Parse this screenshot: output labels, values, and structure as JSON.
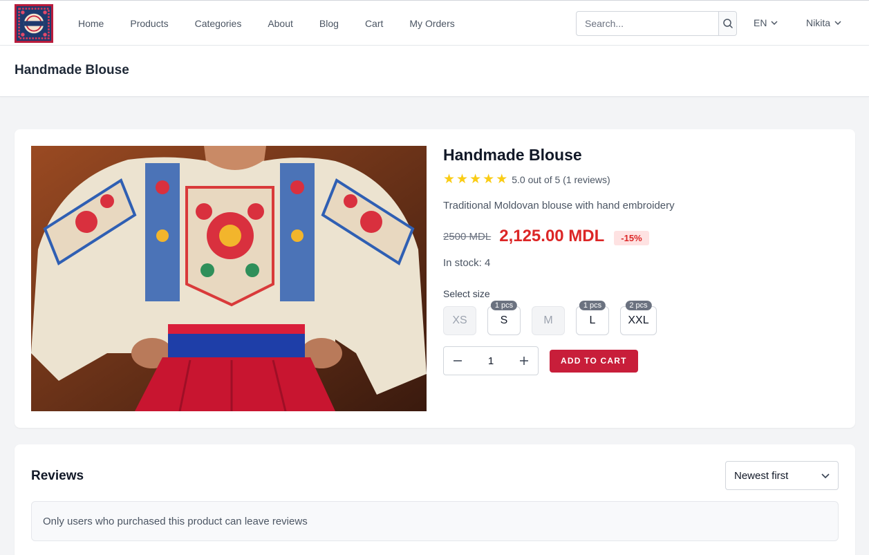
{
  "nav": {
    "logo_text": "HANDMADE",
    "links": [
      "Home",
      "Products",
      "Categories",
      "About",
      "Blog",
      "Cart",
      "My Orders"
    ],
    "search_placeholder": "Search...",
    "language": "EN",
    "user": "Nikita"
  },
  "page": {
    "title": "Handmade Blouse"
  },
  "product": {
    "name": "Handmade Blouse",
    "rating": 5,
    "rating_text": "5.0 out of 5 (1 reviews)",
    "description": "Traditional Moldovan blouse with hand embroidery",
    "old_price": "2500 MDL",
    "new_price": "2,125.00 MDL",
    "discount": "-15%",
    "stock": "In stock: 4",
    "size_label": "Select size",
    "sizes": [
      {
        "label": "XS",
        "available": false,
        "badge": ""
      },
      {
        "label": "S",
        "available": true,
        "badge": "1 pcs"
      },
      {
        "label": "M",
        "available": false,
        "badge": ""
      },
      {
        "label": "L",
        "available": true,
        "badge": "1 pcs"
      },
      {
        "label": "XXL",
        "available": true,
        "badge": "2 pcs"
      }
    ],
    "quantity": "1",
    "add_to_cart": "ADD TO CART"
  },
  "reviews": {
    "title": "Reviews",
    "sort": "Newest first",
    "notice": "Only users who purchased this product can leave reviews"
  },
  "colors": {
    "accent": "#c81e3a",
    "price": "#dc2626",
    "star": "#facc15"
  }
}
